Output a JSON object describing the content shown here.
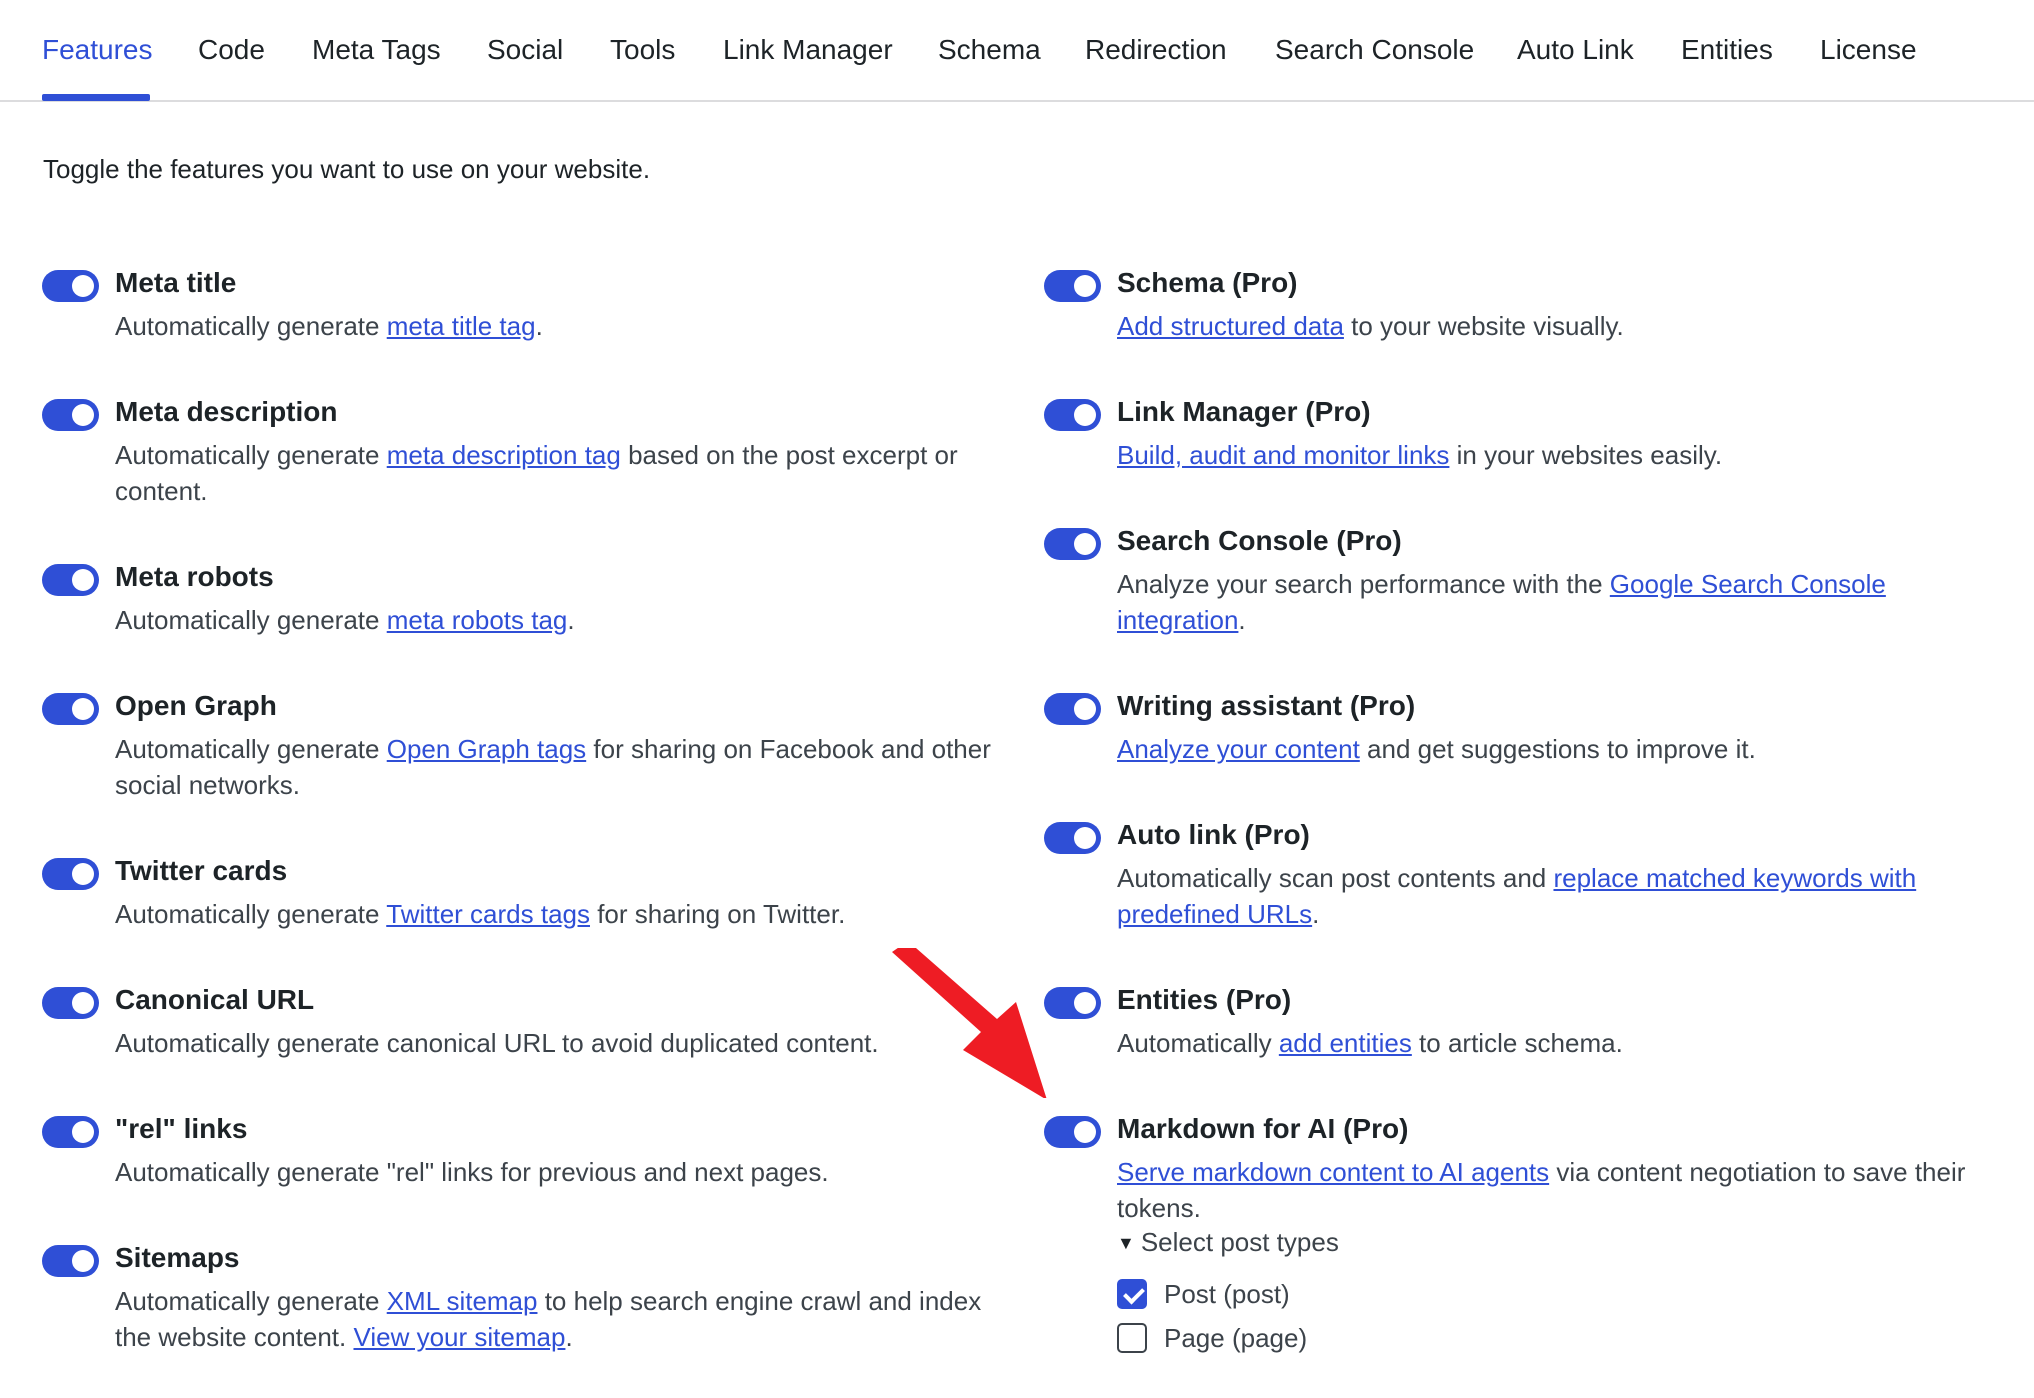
{
  "tabs": [
    "Features",
    "Code",
    "Meta Tags",
    "Social",
    "Tools",
    "Link Manager",
    "Schema",
    "Redirection",
    "Search Console",
    "Auto Link",
    "Entities",
    "License"
  ],
  "active_tab": "Features",
  "intro": "Toggle the features you want to use on your website.",
  "accent_color": "#2f4fd6",
  "annotation_color": "#ee1c24",
  "left": [
    {
      "title": "Meta title",
      "enabled": true,
      "desc": [
        {
          "t": "Automatically generate "
        },
        {
          "t": "meta title tag",
          "link": true
        },
        {
          "t": "."
        }
      ]
    },
    {
      "title": "Meta description",
      "enabled": true,
      "desc": [
        {
          "t": "Automatically generate "
        },
        {
          "t": "meta description tag",
          "link": true
        },
        {
          "t": " based on the post excerpt or content."
        }
      ]
    },
    {
      "title": "Meta robots",
      "enabled": true,
      "desc": [
        {
          "t": "Automatically generate "
        },
        {
          "t": "meta robots tag",
          "link": true
        },
        {
          "t": "."
        }
      ]
    },
    {
      "title": "Open Graph",
      "enabled": true,
      "desc": [
        {
          "t": "Automatically generate "
        },
        {
          "t": "Open Graph tags",
          "link": true
        },
        {
          "t": " for sharing on Facebook and other social networks."
        }
      ]
    },
    {
      "title": "Twitter cards",
      "enabled": true,
      "desc": [
        {
          "t": "Automatically generate "
        },
        {
          "t": "Twitter cards tags",
          "link": true
        },
        {
          "t": " for sharing on Twitter."
        }
      ]
    },
    {
      "title": "Canonical URL",
      "enabled": true,
      "desc": [
        {
          "t": "Automatically generate canonical URL to avoid duplicated content."
        }
      ]
    },
    {
      "title": "\"rel\" links",
      "enabled": true,
      "desc": [
        {
          "t": "Automatically generate \"rel\" links for previous and next pages."
        }
      ]
    },
    {
      "title": "Sitemaps",
      "enabled": true,
      "desc": [
        {
          "t": "Automatically generate "
        },
        {
          "t": "XML sitemap",
          "link": true
        },
        {
          "t": " to help search engine crawl and index the website content. "
        },
        {
          "t": "View your sitemap",
          "link": true
        },
        {
          "t": "."
        }
      ]
    }
  ],
  "right": [
    {
      "title": "Schema (Pro)",
      "enabled": true,
      "desc": [
        {
          "t": "Add structured data",
          "link": true
        },
        {
          "t": " to your website visually."
        }
      ]
    },
    {
      "title": "Link Manager (Pro)",
      "enabled": true,
      "desc": [
        {
          "t": "Build, audit and monitor links",
          "link": true
        },
        {
          "t": " in your websites easily."
        }
      ]
    },
    {
      "title": "Search Console (Pro)",
      "enabled": true,
      "desc": [
        {
          "t": "Analyze your search performance with the "
        },
        {
          "t": "Google Search Console integration",
          "link": true
        },
        {
          "t": "."
        }
      ]
    },
    {
      "title": "Writing assistant (Pro)",
      "enabled": true,
      "desc": [
        {
          "t": "Analyze your content",
          "link": true
        },
        {
          "t": " and get suggestions to improve it."
        }
      ]
    },
    {
      "title": "Auto link (Pro)",
      "enabled": true,
      "desc": [
        {
          "t": "Automatically scan post contents and "
        },
        {
          "t": "replace matched keywords with predefined URLs",
          "link": true
        },
        {
          "t": "."
        }
      ]
    },
    {
      "title": "Entities (Pro)",
      "enabled": true,
      "desc": [
        {
          "t": "Automatically "
        },
        {
          "t": "add entities",
          "link": true
        },
        {
          "t": " to article schema."
        }
      ]
    },
    {
      "title": "Markdown for AI (Pro)",
      "enabled": true,
      "desc": [
        {
          "t": "Serve markdown content to AI agents",
          "link": true
        },
        {
          "t": " via content negotiation to save their tokens."
        }
      ]
    }
  ],
  "post_types": {
    "summary": "Select post types",
    "options": [
      {
        "label": "Post (post)",
        "checked": true
      },
      {
        "label": "Page (page)",
        "checked": false
      }
    ]
  }
}
